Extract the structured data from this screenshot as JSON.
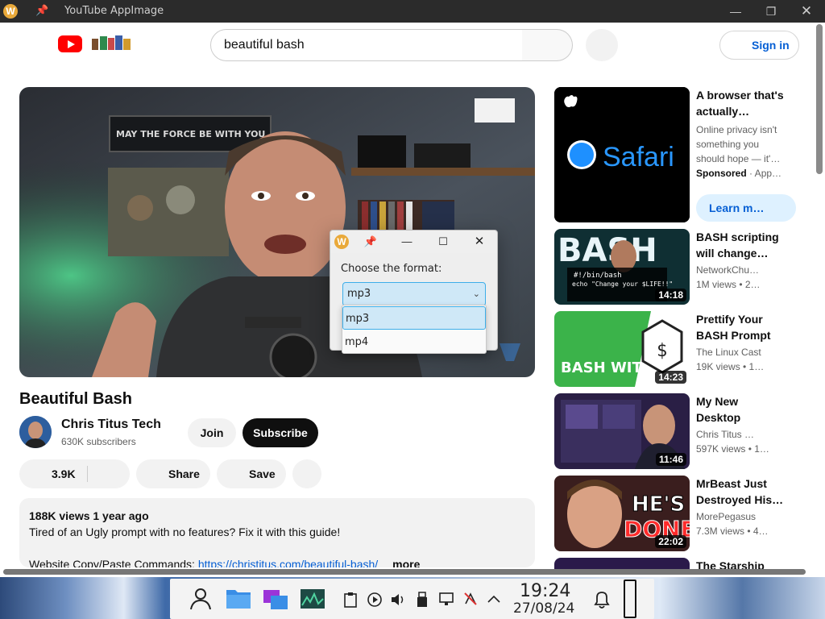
{
  "window": {
    "title": "YouTube AppImage",
    "app_icon_letter": "W"
  },
  "header": {
    "search_value": "beautiful bash",
    "signin_label": "Sign in"
  },
  "video": {
    "overlay_text": "MAY THE FORCE BE WITH YOU",
    "title": "Beautiful Bash",
    "channel_name": "Chris Titus Tech",
    "subscribers": "630K subscribers",
    "join_label": "Join",
    "subscribe_label": "Subscribe",
    "likes": "3.9K",
    "share_label": "Share",
    "save_label": "Save",
    "description": {
      "meta": "188K views  1 year ago",
      "line1": "Tired of an Ugly prompt with no features? Fix it with this guide!",
      "line2_prefix": "Website Copy/Paste Commands: ",
      "line2_link": "https://christitus.com/beautiful-bash/",
      "more": "more"
    }
  },
  "sidebar": {
    "ad": {
      "brand": "Safari",
      "title": "A browser that's actually…",
      "description": "Online privacy isn't something you should hope — it'…",
      "sponsored": "Sponsored",
      "source": "· App…",
      "learn_more": "Learn m…"
    },
    "recommendations": [
      {
        "title": "BASH scripting will change…",
        "channel": "NetworkChu…",
        "views": "1M views  • 2…",
        "duration": "14:18",
        "thumb_text": "BASH",
        "thumb_code": "#!/bin/bash",
        "thumb_echo": "echo \"Change your $LIFE!!\""
      },
      {
        "title": "Prettify Your BASH Prompt",
        "channel": "The Linux Cast",
        "views": "19K views  • 1…",
        "duration": "14:23",
        "thumb_text": "BASH WITH MORE POWER!"
      },
      {
        "title": "My New Desktop",
        "channel": "Chris Titus …",
        "views": "597K views  • 1…",
        "duration": "11:46"
      },
      {
        "title": "MrBeast Just Destroyed His…",
        "channel": "MorePegasus",
        "views": "7.3M views  • 4…",
        "duration": "22:02",
        "thumb_text1": "HE'S",
        "thumb_text2": "DONE"
      },
      {
        "title": "The Starship"
      }
    ]
  },
  "dialog": {
    "label": "Choose the format:",
    "selected": "mp3",
    "options": [
      "mp3",
      "mp4"
    ]
  },
  "taskbar": {
    "time": "19:24",
    "date": "27/08/24"
  },
  "colors": {
    "accent_blue": "#065fd4",
    "youtube_red": "#ff0000",
    "selection_blue": "#3daee9"
  }
}
